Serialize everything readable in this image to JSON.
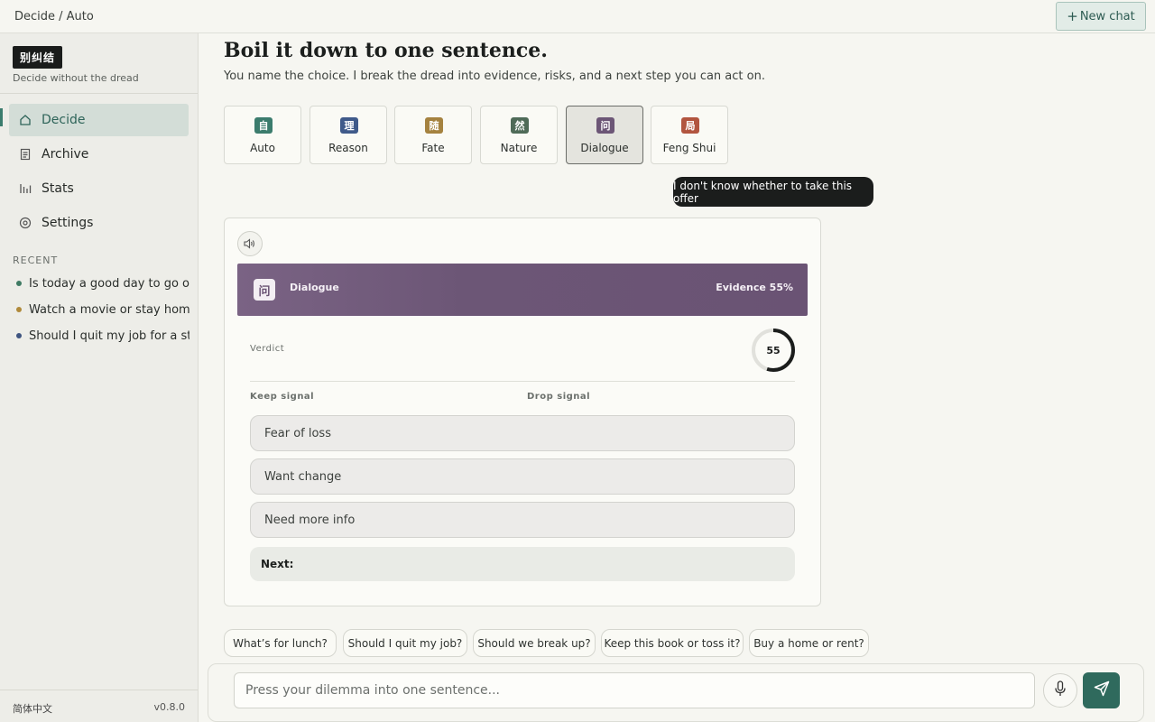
{
  "topbar": {
    "breadcrumb": "Decide / Auto",
    "new_chat_label": "New chat"
  },
  "sidebar": {
    "logo": "别纠结",
    "tagline": "Decide without the dread",
    "nav": [
      {
        "label": "Decide",
        "icon": "home-icon",
        "active": true
      },
      {
        "label": "Archive",
        "icon": "document-icon",
        "active": false
      },
      {
        "label": "Stats",
        "icon": "bar-chart-icon",
        "active": false
      },
      {
        "label": "Settings",
        "icon": "gear-icon",
        "active": false
      }
    ],
    "recent_heading": "RECENT",
    "recent": [
      {
        "label": "Is today a good day to go out?",
        "color": "#3f7a63"
      },
      {
        "label": "Watch a movie or stay home th",
        "color": "#b08a3a"
      },
      {
        "label": "Should I quit my job for a start",
        "color": "#3f5580"
      }
    ],
    "language": "简体中文",
    "version": "v0.8.0"
  },
  "main": {
    "title": "Boil it down to one sentence.",
    "subtitle": "You name the choice. I break the dread into evidence, risks, and a next step you can act on.",
    "modes": [
      {
        "label": "Auto",
        "glyph": "自",
        "color": "#3b7c6d",
        "selected": false
      },
      {
        "label": "Reason",
        "glyph": "理",
        "color": "#3f5a8a",
        "selected": false
      },
      {
        "label": "Fate",
        "glyph": "随",
        "color": "#a5823f",
        "selected": false
      },
      {
        "label": "Nature",
        "glyph": "然",
        "color": "#4f6b58",
        "selected": false
      },
      {
        "label": "Dialogue",
        "glyph": "问",
        "color": "#6c5676",
        "selected": true
      },
      {
        "label": "Feng Shui",
        "glyph": "局",
        "color": "#b2553f",
        "selected": false
      }
    ],
    "user_message": "I don't know whether to take this offer",
    "result": {
      "banner_glyph": "问",
      "banner_name": "Dialogue",
      "evidence_label": "Evidence 55%",
      "verdict_label": "Verdict",
      "score": "55",
      "score_fraction": 0.55,
      "keep_label": "Keep signal",
      "drop_label": "Drop signal",
      "signals": [
        "Fear of loss",
        "Want change",
        "Need more info"
      ],
      "next_label": "Next:"
    },
    "suggestions": [
      "What’s for lunch?",
      "Should I quit my job?",
      "Should we break up?",
      "Keep this book or toss it?",
      "Buy a home or rent?"
    ]
  },
  "composer": {
    "placeholder": "Press your dilemma into one sentence..."
  }
}
